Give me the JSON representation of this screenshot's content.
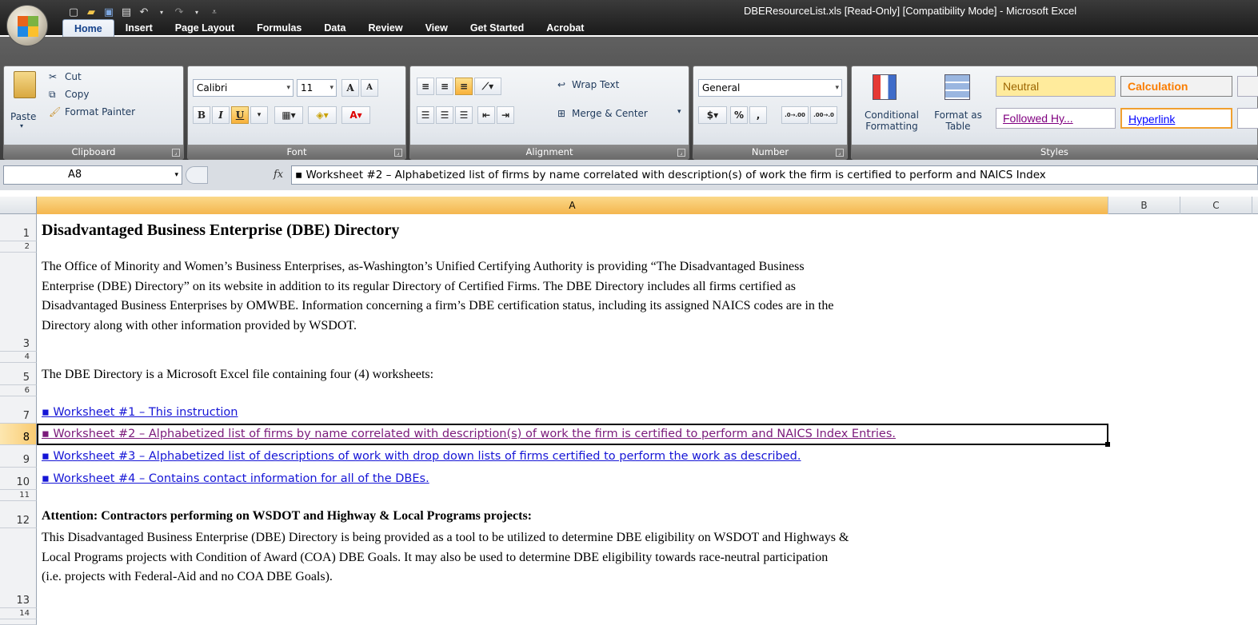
{
  "window": {
    "title": "DBEResourceList.xls  [Read-Only]  [Compatibility Mode] - Microsoft Excel"
  },
  "ribbon": {
    "tabs": [
      "Home",
      "Insert",
      "Page Layout",
      "Formulas",
      "Data",
      "Review",
      "View",
      "Get Started",
      "Acrobat"
    ],
    "active_tab": "Home",
    "clipboard": {
      "paste": "Paste",
      "cut": "Cut",
      "copy": "Copy",
      "format_painter": "Format Painter",
      "label": "Clipboard"
    },
    "font": {
      "name": "Calibri",
      "size": "11",
      "bold": "B",
      "italic": "I",
      "underline": "U",
      "grow": "A",
      "shrink": "A",
      "label": "Font"
    },
    "alignment": {
      "wrap_text": "Wrap Text",
      "merge_center": "Merge & Center",
      "label": "Alignment"
    },
    "number": {
      "format": "General",
      "currency": "$",
      "percent": "%",
      "comma": ",",
      "inc_decimal": ".0→.00",
      "dec_decimal": ".00→.0",
      "label": "Number"
    },
    "styles": {
      "conditional_formatting": "Conditional Formatting",
      "format_as_table": "Format as Table",
      "neutral": "Neutral",
      "calculation": "Calculation",
      "followed_hyperlink": "Followed Hy...",
      "hyperlink": "Hyperlink",
      "label": "Styles"
    }
  },
  "formula_bar": {
    "name_box": "A8",
    "fx": "fx",
    "content": "▪ Worksheet #2 – Alphabetized list of firms by name correlated with description(s) of work the firm is certified to perform and NAICS Index"
  },
  "columns": [
    "A",
    "B",
    "C"
  ],
  "rows": [
    "1",
    "2",
    "3",
    "4",
    "5",
    "6",
    "7",
    "8",
    "9",
    "10",
    "11",
    "12",
    "13",
    "14"
  ],
  "sheet": {
    "title": "Disadvantaged Business Enterprise (DBE) Directory",
    "intro_lines": [
      "The Office of Minority and Women’s Business Enterprises, as-Washington’s Unified Certifying Authority is providing “The Disadvantaged Business",
      "Enterprise (DBE) Directory” on its website in addition to its regular Directory of Certified Firms. The DBE Directory includes all firms certified as",
      "Disadvantaged Business Enterprises by OMWBE. Information concerning a firm’s DBE certification status, including its assigned NAICS codes are in the",
      "Directory along with other information provided by WSDOT."
    ],
    "worksheets_intro": "The DBE Directory is a Microsoft Excel file containing four (4) worksheets:",
    "links": [
      "▪ Worksheet #1 – This instruction",
      "▪ Worksheet #2 – Alphabetized list of firms by name correlated with description(s) of work the firm is certified to perform and NAICS Index Entries.",
      "▪ Worksheet #3 – Alphabetized list of descriptions of work with drop down lists of firms certified to perform the work as described.",
      "▪ Worksheet #4 – Contains contact information for all of the DBEs."
    ],
    "attention_heading": "Attention: Contractors performing on WSDOT and Highway & Local Programs projects:",
    "attention_lines": [
      "This Disadvantaged Business Enterprise (DBE) Directory is being provided as a tool to be utilized to determine DBE eligibility on WSDOT and Highways &",
      "Local Programs projects with Condition of Award (COA) DBE Goals. It may also be used to determine DBE eligibility towards race-neutral participation",
      "(i.e. projects with Federal-Aid and no COA DBE Goals)."
    ]
  }
}
